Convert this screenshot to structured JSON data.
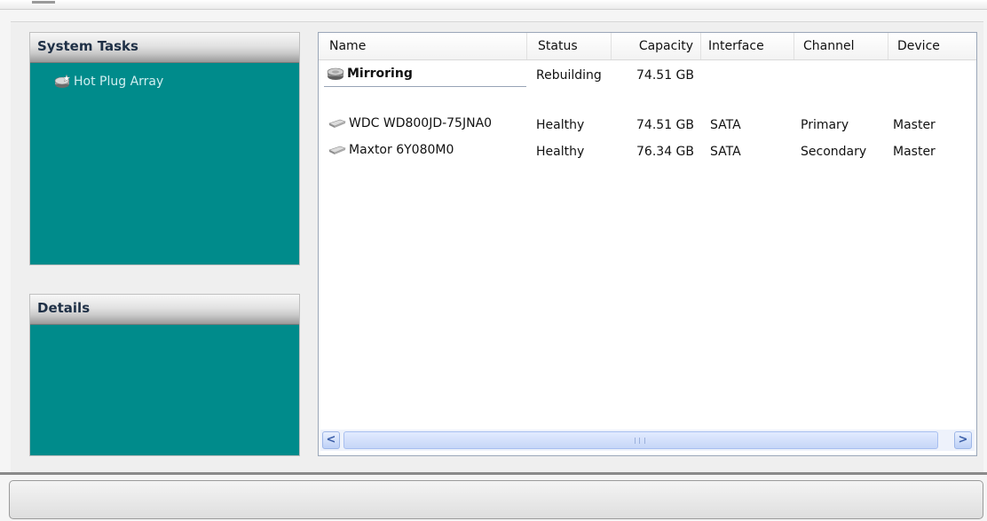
{
  "task_panels": {
    "system_tasks_title": "System Tasks",
    "details_title": "Details",
    "items": [
      {
        "label": "Hot Plug Array",
        "icon": "hot-plug-array-icon"
      }
    ]
  },
  "list": {
    "columns": {
      "name": "Name",
      "status": "Status",
      "capacity": "Capacity",
      "interface": "Interface",
      "channel": "Channel",
      "device": "Device"
    },
    "array": {
      "name": "Mirroring",
      "status": "Rebuilding",
      "capacity": "74.51 GB",
      "icon": "raid-array-icon"
    },
    "disks": [
      {
        "name": "WDC WD800JD-75JNA0",
        "status": "Healthy",
        "capacity": "74.51 GB",
        "interface": "SATA",
        "channel": "Primary",
        "device": "Master",
        "icon": "hard-disk-icon"
      },
      {
        "name": "Maxtor 6Y080M0",
        "status": "Healthy",
        "capacity": "76.34 GB",
        "interface": "SATA",
        "channel": "Secondary",
        "device": "Master",
        "icon": "hard-disk-icon"
      }
    ]
  },
  "scrollbar": {
    "left_arrow": "<",
    "right_arrow": ">"
  },
  "colors": {
    "panel_bg": "#008b8b",
    "panel_title": "#1f3046",
    "task_link": "#d0eef0"
  }
}
